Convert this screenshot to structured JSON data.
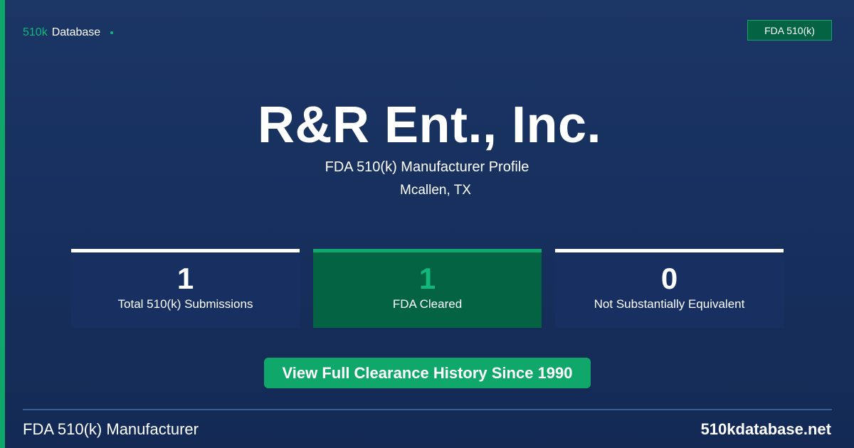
{
  "header": {
    "logo_prefix": "510k",
    "logo_suffix": "Database",
    "badge": "FDA 510(k)"
  },
  "hero": {
    "company_name": "R&R Ent., Inc.",
    "subtitle": "FDA 510(k) Manufacturer Profile",
    "location": "Mcallen, TX"
  },
  "stats": [
    {
      "value": "1",
      "label": "Total 510(k) Submissions"
    },
    {
      "value": "1",
      "label": "FDA Cleared"
    },
    {
      "value": "0",
      "label": "Not Substantially Equivalent"
    }
  ],
  "cta": {
    "label": "View Full Clearance History Since 1990"
  },
  "footer": {
    "left": "FDA 510(k) Manufacturer",
    "right": "510kdatabase.net"
  },
  "colors": {
    "accent_green": "#0fa86a",
    "background_navy": "#17305e",
    "card_green": "#036342"
  }
}
